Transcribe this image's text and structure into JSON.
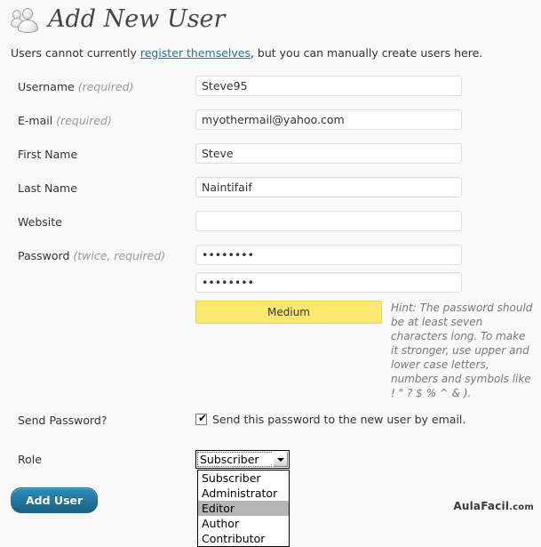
{
  "header": {
    "icon": "users-icon",
    "title": "Add New User"
  },
  "intro": {
    "before_link": "Users cannot currently ",
    "link_text": "register themselves",
    "after_link": ", but you can manually create users here."
  },
  "form": {
    "fields": [
      {
        "label": "Username",
        "note": " (required)",
        "value": "Steve95",
        "placeholder": ""
      },
      {
        "label": "E-mail",
        "note": " (required)",
        "value": "myothermail@yahoo.com",
        "placeholder": ""
      },
      {
        "label": "First Name",
        "note": "",
        "value": "Steve",
        "placeholder": ""
      },
      {
        "label": "Last Name",
        "note": "",
        "value": "Naintifaif",
        "placeholder": ""
      },
      {
        "label": "Website",
        "note": "",
        "value": "",
        "placeholder": ""
      }
    ],
    "password": {
      "label": "Password",
      "note": " (twice, required)",
      "value_1": "••••••••",
      "value_2": "••••••••",
      "strength_label": "Medium",
      "strength_color": "#fbe870",
      "hint": "Hint: The password should be at least seven characters long. To make it stronger, use upper and lower case letters, numbers and symbols like ! \" ? $ % ^ & )."
    },
    "send_password": {
      "label": "Send Password?",
      "checkbox_checked": true,
      "checkbox_glyph": "✔",
      "checkbox_label": "Send this password to the new user by email."
    },
    "role": {
      "label": "Role",
      "selected": "Subscriber",
      "highlighted": "Editor",
      "options": [
        "Subscriber",
        "Administrator",
        "Editor",
        "Author",
        "Contributor"
      ]
    },
    "submit_label": "Add User"
  },
  "watermark": {
    "name": "AulaFacil",
    "tld": ".com"
  }
}
